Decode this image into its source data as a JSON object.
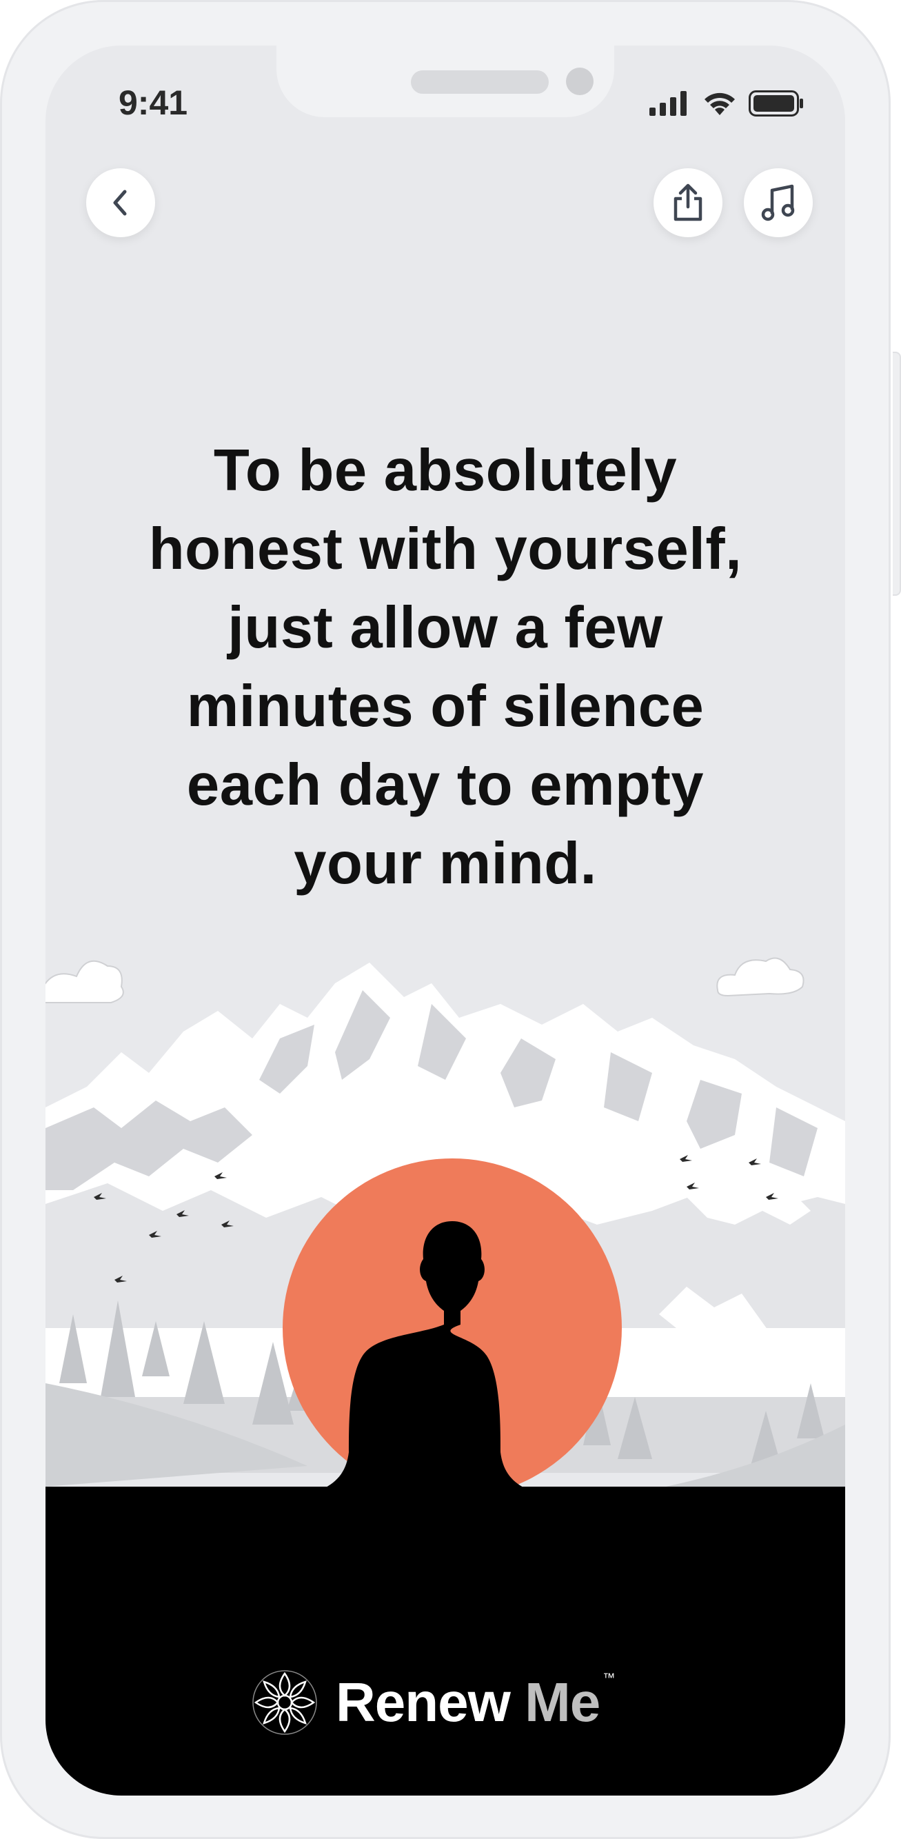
{
  "status_bar": {
    "time": "9:41"
  },
  "toolbar": {
    "back_icon": "chevron-left-icon",
    "share_icon": "share-icon",
    "music_icon": "music-note-icon"
  },
  "quote": {
    "lines": [
      "To be absolutely",
      "honest with yourself,",
      "just allow a few",
      "minutes of silence",
      "each day to empty",
      "your mind."
    ]
  },
  "brand": {
    "name_part1": "Renew",
    "name_part2": "Me",
    "trademark": "™"
  },
  "colors": {
    "sun": "#ef7b5a",
    "screen_bg": "#e8e9ec",
    "ground": "#000000"
  }
}
